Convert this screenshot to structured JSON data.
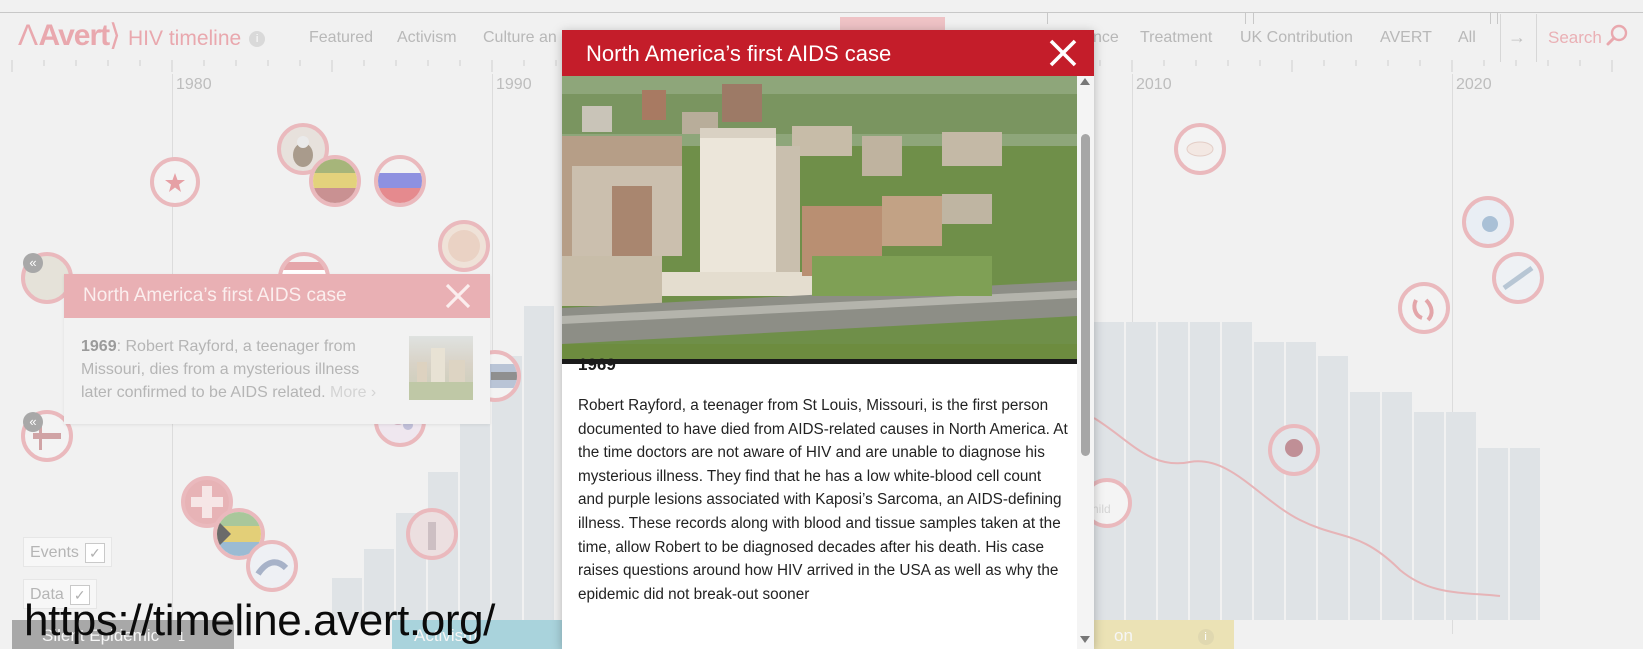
{
  "header": {
    "logo": "Avert",
    "app_title": "HIV timeline",
    "info_glyph": "i",
    "nav_items": [
      "Featured",
      "Activism",
      "Culture an",
      "nce",
      "Treatment",
      "UK Contribution",
      "AVERT",
      "All"
    ],
    "next_arrow": "→",
    "search_label": "Search"
  },
  "timeline": {
    "years": [
      "1980",
      "1990",
      "2010",
      "2020"
    ]
  },
  "mini_card": {
    "title": "North America’s first AIDS case",
    "year": "1969",
    "text": ": Robert Rayford, a teenager from Missouri, dies from a mysterious illness later confirmed to be AIDS related.",
    "more_label": "More ›"
  },
  "collapse_glyph": "«",
  "filters": {
    "events_label": "Events",
    "data_label": "Data",
    "check_glyph": "✓"
  },
  "eras": {
    "silent_epidemic": "Silent Epidemic",
    "silent_epidemic_num": "1",
    "activism": "Activism",
    "last_fragment": "on",
    "last_info": "i"
  },
  "event_fragment": "hild",
  "url_overlay": "https://timeline.avert.org/",
  "modal": {
    "title": "North America’s first AIDS case",
    "year": "1969",
    "body": "Robert Rayford, a teenager from St Louis, Missouri, is the first person documented to have died from AIDS-related causes in North America. At the time doctors are not aware of HIV and are unable to diagnose his mysterious illness. They find that he has a low white-blood cell count and purple lesions associated with Kaposi’s Sarcoma, an AIDS-defining illness. These records along with blood and tissue samples taken at the time, allow Robert to be diagnosed decades after his death. His case raises questions around how HIV arrived in the USA as well as why the epidemic did not break-out sooner"
  },
  "colors": {
    "brand_red": "#c41d2a",
    "faded_pink": "#e9b0b4",
    "data_bar": "#dfe3e6"
  }
}
